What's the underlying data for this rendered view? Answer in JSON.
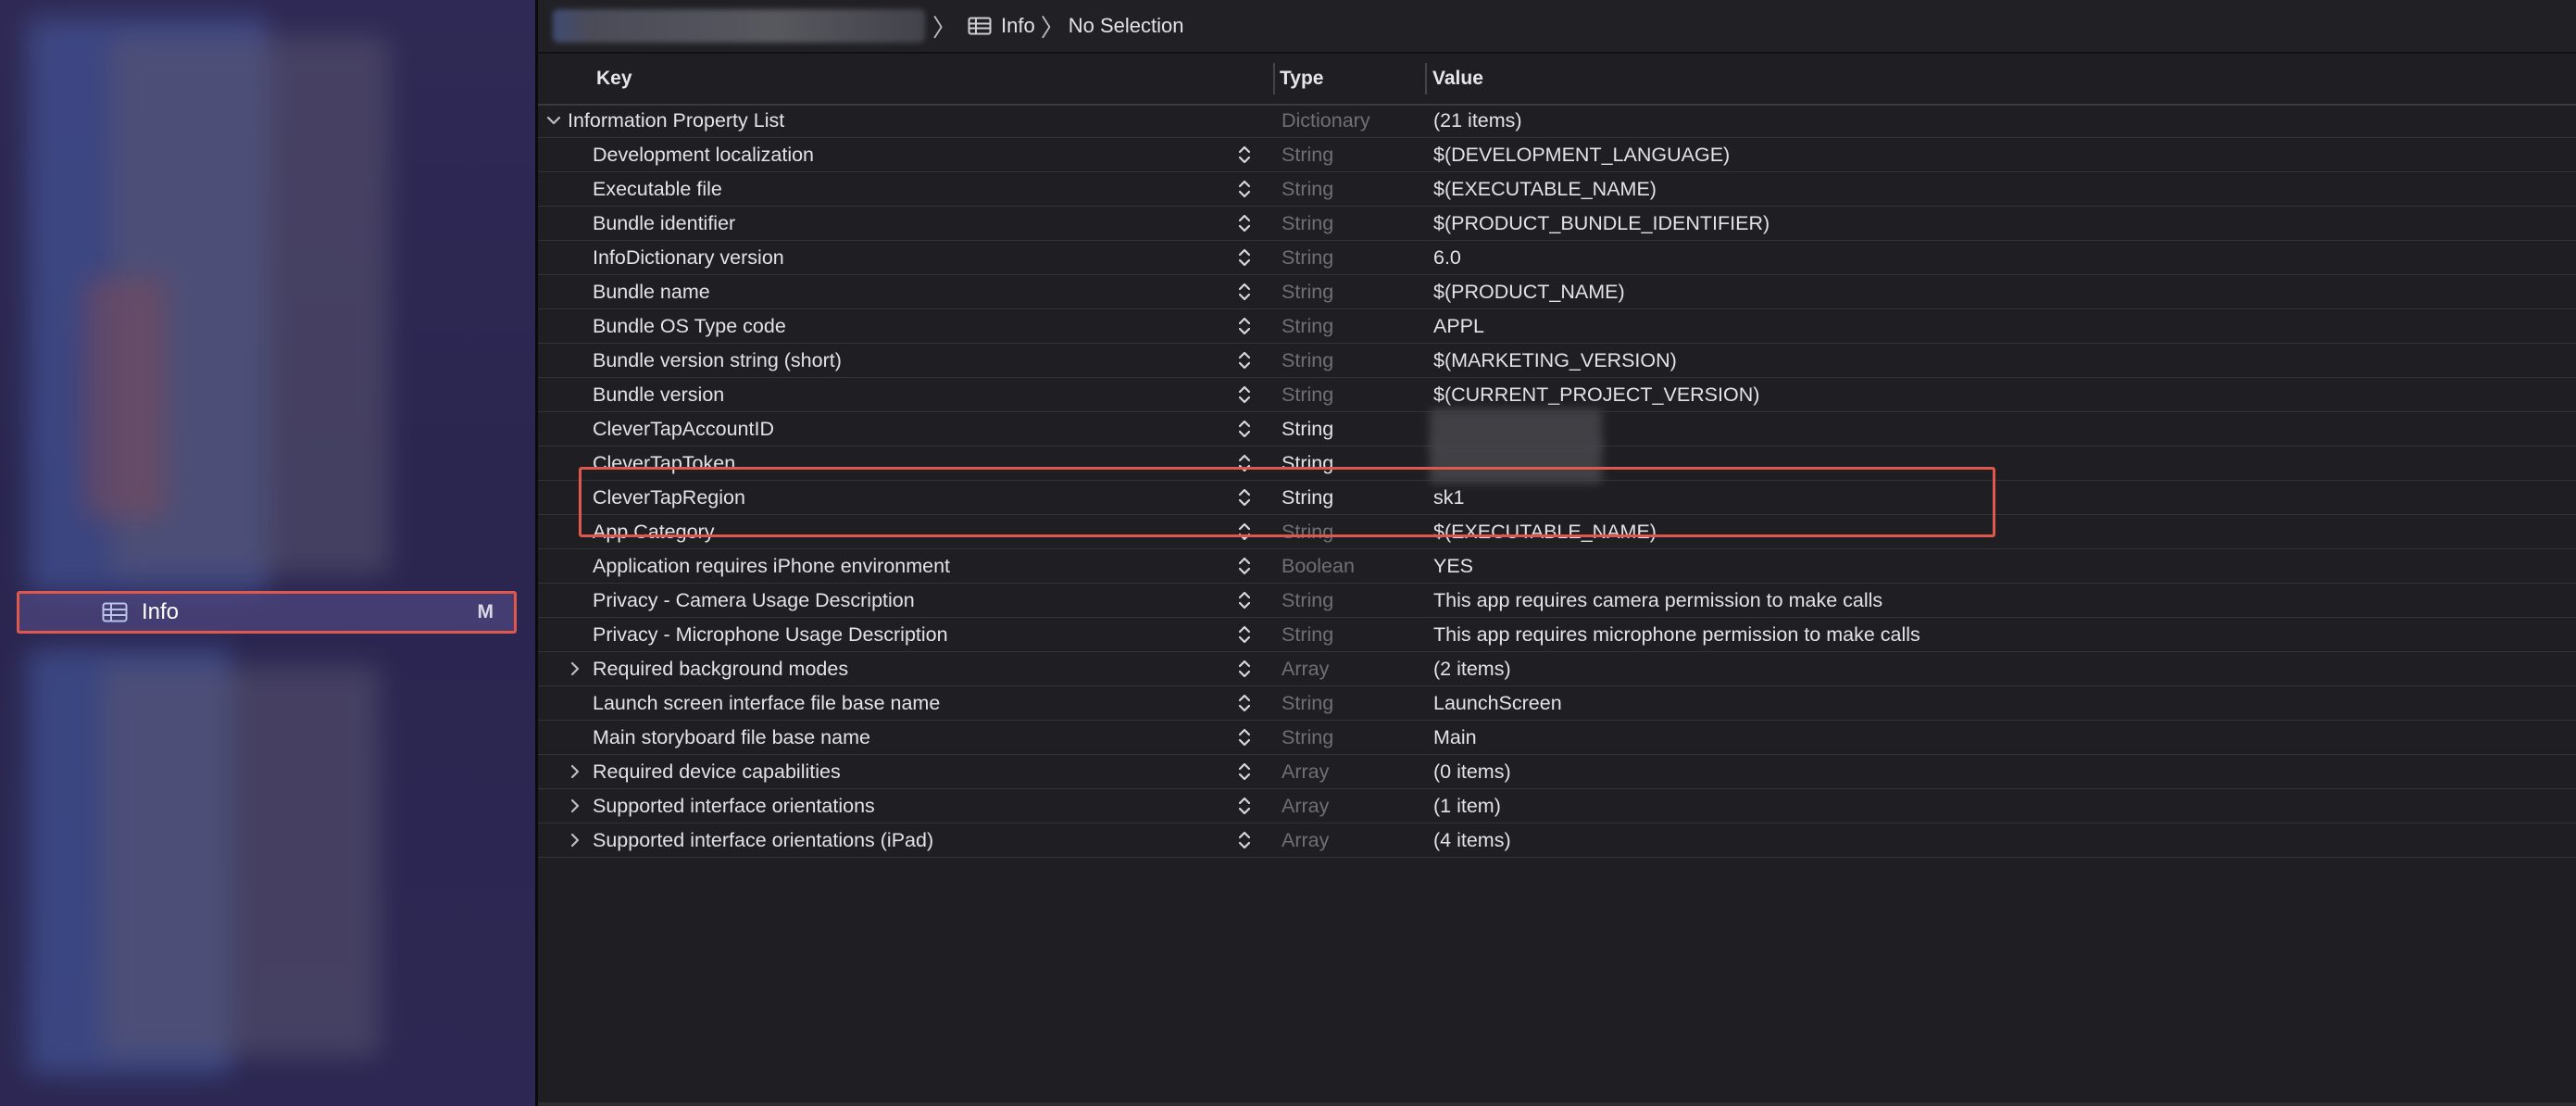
{
  "sidebar": {
    "selected_item": {
      "icon": "table-icon",
      "label": "Info",
      "badge": "M"
    }
  },
  "breadcrumb": {
    "items": [
      {
        "label": "Info",
        "icon": "table-icon"
      },
      {
        "label": "No Selection"
      }
    ],
    "separator": "〉"
  },
  "columns": {
    "key": "Key",
    "type": "Type",
    "value": "Value"
  },
  "rows": [
    {
      "key": "Information Property List",
      "type": "Dictionary",
      "value": "(21 items)",
      "root": true,
      "expanded": true,
      "type_dim": true
    },
    {
      "key": "Development localization",
      "type": "String",
      "value": "$(DEVELOPMENT_LANGUAGE)",
      "type_dim": true
    },
    {
      "key": "Executable file",
      "type": "String",
      "value": "$(EXECUTABLE_NAME)",
      "type_dim": true
    },
    {
      "key": "Bundle identifier",
      "type": "String",
      "value": "$(PRODUCT_BUNDLE_IDENTIFIER)",
      "type_dim": true
    },
    {
      "key": "InfoDictionary version",
      "type": "String",
      "value": "6.0",
      "type_dim": true
    },
    {
      "key": "Bundle name",
      "type": "String",
      "value": "$(PRODUCT_NAME)",
      "type_dim": true
    },
    {
      "key": "Bundle OS Type code",
      "type": "String",
      "value": "APPL",
      "type_dim": true
    },
    {
      "key": "Bundle version string (short)",
      "type": "String",
      "value": "$(MARKETING_VERSION)",
      "type_dim": true
    },
    {
      "key": "Bundle version",
      "type": "String",
      "value": "$(CURRENT_PROJECT_VERSION)",
      "type_dim": true
    },
    {
      "key": "CleverTapAccountID",
      "type": "String",
      "value": "",
      "type_dim": false,
      "value_redacted": true
    },
    {
      "key": "CleverTapToken",
      "type": "String",
      "value": "",
      "type_dim": false,
      "value_redacted": true
    },
    {
      "key": "CleverTapRegion",
      "type": "String",
      "value": "sk1",
      "type_dim": false
    },
    {
      "key": "App Category",
      "type": "String",
      "value": "$(EXECUTABLE_NAME)",
      "type_dim": true
    },
    {
      "key": "Application requires iPhone environment",
      "type": "Boolean",
      "value": "YES",
      "type_dim": true
    },
    {
      "key": "Privacy - Camera Usage Description",
      "type": "String",
      "value": "This app requires camera permission to make calls",
      "type_dim": true
    },
    {
      "key": "Privacy - Microphone Usage Description",
      "type": "String",
      "value": "This app requires microphone permission to make calls",
      "type_dim": true
    },
    {
      "key": "Required background modes",
      "type": "Array",
      "value": "(2 items)",
      "type_dim": true,
      "collapsible": true
    },
    {
      "key": "Launch screen interface file base name",
      "type": "String",
      "value": "LaunchScreen",
      "type_dim": true
    },
    {
      "key": "Main storyboard file base name",
      "type": "String",
      "value": "Main",
      "type_dim": true
    },
    {
      "key": "Required device capabilities",
      "type": "Array",
      "value": "(0 items)",
      "type_dim": true,
      "collapsible": true
    },
    {
      "key": "Supported interface orientations",
      "type": "Array",
      "value": "(1 item)",
      "type_dim": true,
      "collapsible": true
    },
    {
      "key": "Supported interface orientations (iPad)",
      "type": "Array",
      "value": "(4 items)",
      "type_dim": true,
      "collapsible": true
    }
  ],
  "colors": {
    "highlight": "#e0574c",
    "dim_type": "#6f6f76",
    "sidebar_bg": "#2c2853"
  }
}
